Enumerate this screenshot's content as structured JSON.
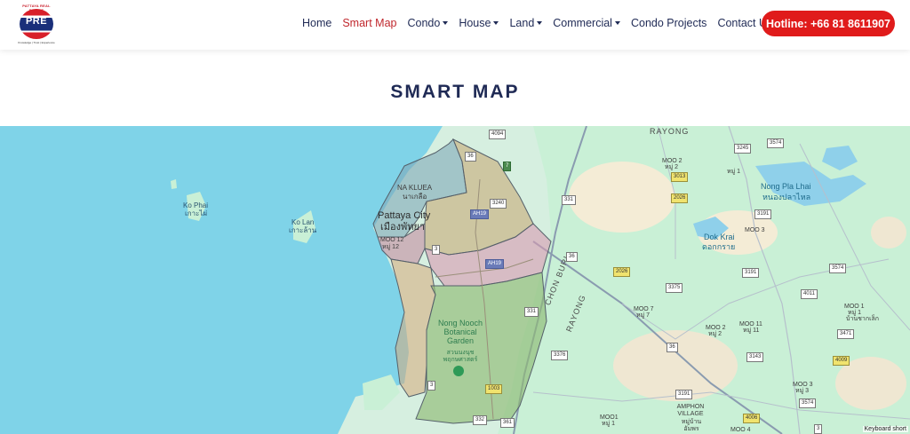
{
  "header": {
    "logo_arc_text": "PATTAYA REAL ESTATE",
    "logo_text": "PRE",
    "logo_tagline": "Knowledge | Trust | Experience",
    "nav": [
      {
        "label": "Home",
        "active": false,
        "dropdown": false
      },
      {
        "label": "Smart Map",
        "active": true,
        "dropdown": false
      },
      {
        "label": "Condo",
        "active": false,
        "dropdown": true
      },
      {
        "label": "House",
        "active": false,
        "dropdown": true
      },
      {
        "label": "Land",
        "active": false,
        "dropdown": true
      },
      {
        "label": "Commercial",
        "active": false,
        "dropdown": true
      },
      {
        "label": "Condo Projects",
        "active": false,
        "dropdown": false
      },
      {
        "label": "Contact Us",
        "active": false,
        "dropdown": false
      }
    ],
    "hotline_label": "Hotline: +66 81 8611907"
  },
  "page": {
    "title": "SMART MAP"
  },
  "map": {
    "labels": {
      "rayong_top": "RAYONG",
      "na_kluea": "NA KLUEA",
      "na_kluea_th": "นาเกลือ",
      "pattaya": "Pattaya City",
      "pattaya_th": "เมืองพัทยา",
      "moo12": "MOO 12",
      "moo12_th": "หมู่ 12",
      "ko_phai": "Ko Phai",
      "ko_phai_th": "เกาะไผ่",
      "ko_lan": "Ko Lan",
      "ko_lan_th": "เกาะล้าน",
      "nong_nooch": "Nong Nooch Botanical Garden",
      "nong_nooch_th": "สวนนงนุช พฤกษศาสตร์",
      "chon_buri": "CHON BURI",
      "rayong_mid": "RAYONG",
      "nong_pla_lhai": "Nong Pla Lhai",
      "nong_pla_lhai_th": "หนองปลาไหล",
      "dok_krai": "Dok Krai",
      "dok_krai_th": "ดอกกราย",
      "moo2_a": "MOO 2",
      "moo2_a_th": "หมู่ 2",
      "moo1_a": "หมู่ 1",
      "moo3_a": "MOO 3",
      "moo7": "MOO 7",
      "moo7_th": "หมู่ 7",
      "moo2_b": "MOO 2",
      "moo2_b_th": "หมู่ 2",
      "moo11": "MOO 11",
      "moo11_th": "หมู่ 11",
      "moo1_b": "MOO 1",
      "moo1_b_th": "หมู่ 1",
      "moo1_b_th2": "บ้านชากเล็ก",
      "moo3_b": "MOO 3",
      "moo3_b_th": "หมู่ 3",
      "amphon": "AMPHON VILLAGE",
      "amphon_th": "หมู่บ้าน อัมพร",
      "moo1_c": "MOO1",
      "moo1_c_th": "หมู่ 1",
      "moo4": "MOO 4",
      "keyboard": "Keyboard short"
    },
    "roads": {
      "r4094": "4094",
      "r36a": "36",
      "r7": "7",
      "r3240": "3240",
      "ah19a": "AH19",
      "r331a": "331",
      "ah19b": "AH19",
      "r3": "3",
      "r36b": "36",
      "r2026a": "2026",
      "r331b": "331",
      "r3376": "3376",
      "r3a": "3",
      "r1003": "1003",
      "r332": "332",
      "r361": "361",
      "r3245": "3245",
      "r3574a": "3574",
      "r3013": "3013",
      "r2026b": "2026",
      "r3191a": "3191",
      "r3375": "3375",
      "r3191b": "3191",
      "r3574b": "3574",
      "r4011": "4011",
      "r36c": "36",
      "r3471": "3471",
      "r3143": "3143",
      "r4009": "4009",
      "r3191c": "3191",
      "r3574c": "3574",
      "r4006": "4006",
      "r3b": "3"
    }
  }
}
